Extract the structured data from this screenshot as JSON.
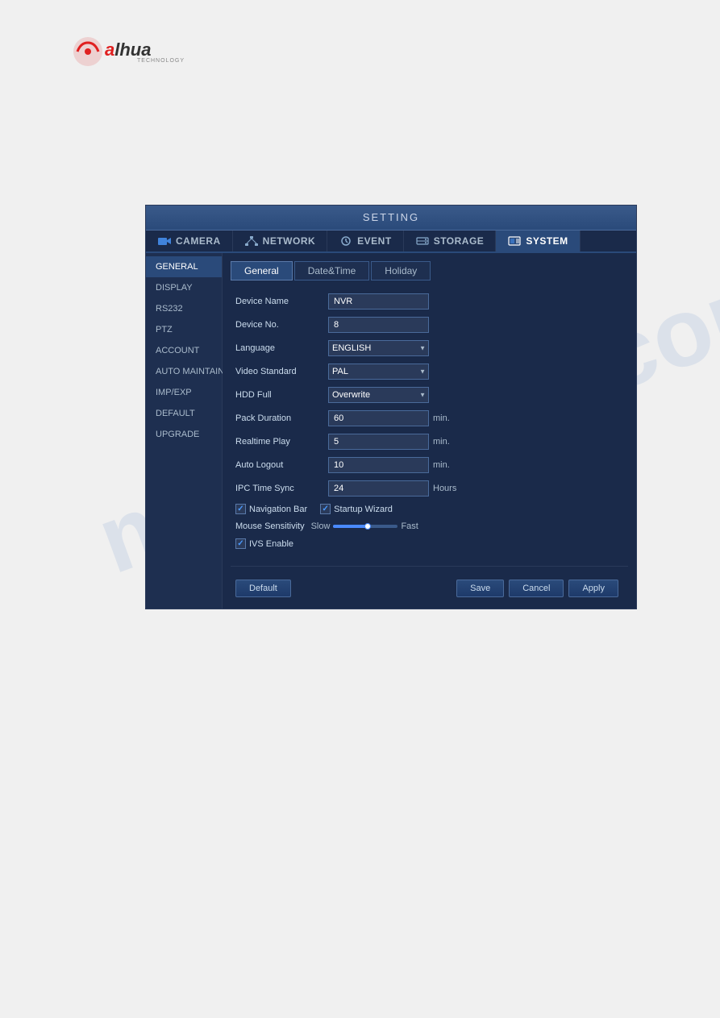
{
  "logo": {
    "brand": "alhua",
    "subtitle": "TECHNOLOGY"
  },
  "watermark": "manualslib.com",
  "ui": {
    "title": "SETTING",
    "nav_tabs": [
      {
        "id": "camera",
        "label": "CAMERA",
        "active": false
      },
      {
        "id": "network",
        "label": "NETWORK",
        "active": false
      },
      {
        "id": "event",
        "label": "EVENT",
        "active": false
      },
      {
        "id": "storage",
        "label": "STORAGE",
        "active": false
      },
      {
        "id": "system",
        "label": "SYSTEM",
        "active": true
      }
    ],
    "sidebar": {
      "items": [
        {
          "id": "general",
          "label": "GENERAL",
          "active": true
        },
        {
          "id": "display",
          "label": "DISPLAY",
          "active": false
        },
        {
          "id": "rs232",
          "label": "RS232",
          "active": false
        },
        {
          "id": "ptz",
          "label": "PTZ",
          "active": false
        },
        {
          "id": "account",
          "label": "ACCOUNT",
          "active": false
        },
        {
          "id": "auto_maintain",
          "label": "AUTO MAINTAIN",
          "active": false
        },
        {
          "id": "imp_exp",
          "label": "IMP/EXP",
          "active": false
        },
        {
          "id": "default",
          "label": "DEFAULT",
          "active": false
        },
        {
          "id": "upgrade",
          "label": "UPGRADE",
          "active": false
        }
      ]
    },
    "sub_tabs": [
      {
        "id": "general",
        "label": "General",
        "active": true
      },
      {
        "id": "datetime",
        "label": "Date&Time",
        "active": false
      },
      {
        "id": "holiday",
        "label": "Holiday",
        "active": false
      }
    ],
    "form": {
      "device_name_label": "Device Name",
      "device_name_value": "NVR",
      "device_no_label": "Device No.",
      "device_no_value": "8",
      "language_label": "Language",
      "language_value": "ENGLISH",
      "video_standard_label": "Video Standard",
      "video_standard_value": "PAL",
      "hdd_full_label": "HDD Full",
      "hdd_full_value": "Overwrite",
      "pack_duration_label": "Pack Duration",
      "pack_duration_value": "60",
      "pack_duration_unit": "min.",
      "realtime_play_label": "Realtime Play",
      "realtime_play_value": "5",
      "realtime_play_unit": "min.",
      "auto_logout_label": "Auto Logout",
      "auto_logout_value": "10",
      "auto_logout_unit": "min.",
      "ipc_time_sync_label": "IPC Time Sync",
      "ipc_time_sync_value": "24",
      "ipc_time_sync_unit": "Hours",
      "navigation_bar_label": "Navigation Bar",
      "navigation_bar_checked": true,
      "startup_wizard_label": "Startup Wizard",
      "startup_wizard_checked": true,
      "mouse_sensitivity_label": "Mouse Sensitivity",
      "slow_label": "Slow",
      "fast_label": "Fast",
      "ivs_enable_label": "IVS Enable",
      "ivs_enable_checked": true
    },
    "buttons": {
      "default_label": "Default",
      "save_label": "Save",
      "cancel_label": "Cancel",
      "apply_label": "Apply"
    }
  }
}
